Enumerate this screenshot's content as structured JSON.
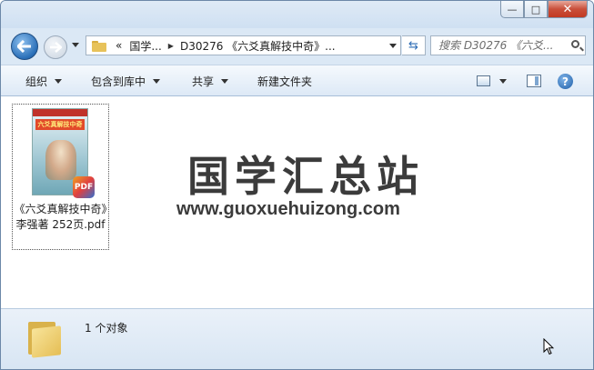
{
  "window": {
    "caption_buttons": {
      "minimize": "—",
      "maximize": "□",
      "close": "✕"
    }
  },
  "navigation": {
    "back_icon": "back-arrow-icon",
    "forward_icon": "forward-arrow-icon",
    "breadcrumb": {
      "overflow": "«",
      "items": [
        "国学...",
        "D30276 《六爻真解技中奇》..."
      ]
    },
    "refresh_icon": "⇆",
    "search": {
      "placeholder": "搜索 D30276 《六爻..."
    }
  },
  "toolbar": {
    "organize": "组织",
    "include_in_library": "包含到库中",
    "share": "共享",
    "new_folder": "新建文件夹",
    "help": "?"
  },
  "files": [
    {
      "name": "《六爻真解技中奇》李强著 252页.pdf",
      "thumb_title": "六爻真解技中奇",
      "badge": "PDF"
    }
  ],
  "watermark": {
    "chinese": "国学汇总站",
    "url": "www.guoxuehuizong.com"
  },
  "status": {
    "count": "1 个对象"
  }
}
